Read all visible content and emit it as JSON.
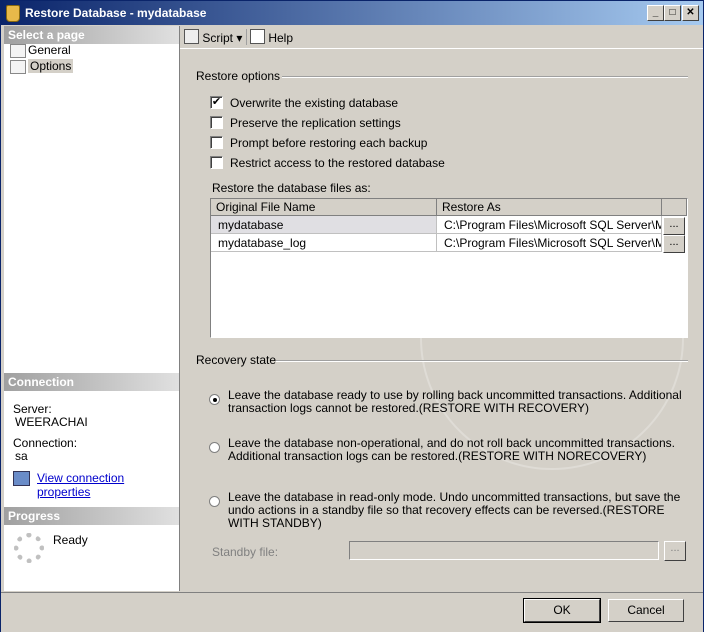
{
  "window": {
    "title": "Restore Database - mydatabase"
  },
  "left": {
    "select_page_header": "Select a page",
    "pages": [
      {
        "label": "General"
      },
      {
        "label": "Options"
      }
    ],
    "connection_header": "Connection",
    "server_label": "Server:",
    "server_value": "WEERACHAI",
    "connection_label": "Connection:",
    "connection_value": "sa",
    "view_props_link": "View connection properties",
    "progress_header": "Progress",
    "progress_status": "Ready"
  },
  "toolbar": {
    "script_label": "Script",
    "help_label": "Help"
  },
  "restore_options": {
    "group_label": "Restore options",
    "checkboxes": [
      {
        "label": "Overwrite the existing database",
        "checked": "✔"
      },
      {
        "label": "Preserve the replication settings",
        "checked": ""
      },
      {
        "label": "Prompt before restoring each backup",
        "checked": ""
      },
      {
        "label": "Restrict access to the restored database",
        "checked": ""
      }
    ],
    "files_label": "Restore the database files as:",
    "table": {
      "columns": [
        "Original File Name",
        "Restore As"
      ],
      "rows": [
        {
          "original": "mydatabase",
          "restore_as": "C:\\Program Files\\Microsoft SQL Server\\M...",
          "browse": "..."
        },
        {
          "original": "mydatabase_log",
          "restore_as": "C:\\Program Files\\Microsoft SQL Server\\M...",
          "browse": "..."
        }
      ]
    }
  },
  "recovery": {
    "group_label": "Recovery state",
    "options": [
      {
        "text": "Leave the database ready to use by rolling back uncommitted transactions. Additional transaction logs cannot be restored.(RESTORE WITH RECOVERY)",
        "selected": true
      },
      {
        "text": "Leave the database non-operational, and do not roll back uncommitted transactions. Additional transaction logs can be restored.(RESTORE WITH NORECOVERY)",
        "selected": false
      },
      {
        "text": "Leave the database in read-only mode. Undo uncommitted transactions, but save the undo actions in a standby file so that recovery effects can be reversed.(RESTORE WITH STANDBY)",
        "selected": false
      }
    ],
    "standby_label": "Standby file:",
    "standby_value": "",
    "standby_browse": "..."
  },
  "buttons": {
    "ok": "OK",
    "cancel": "Cancel"
  }
}
